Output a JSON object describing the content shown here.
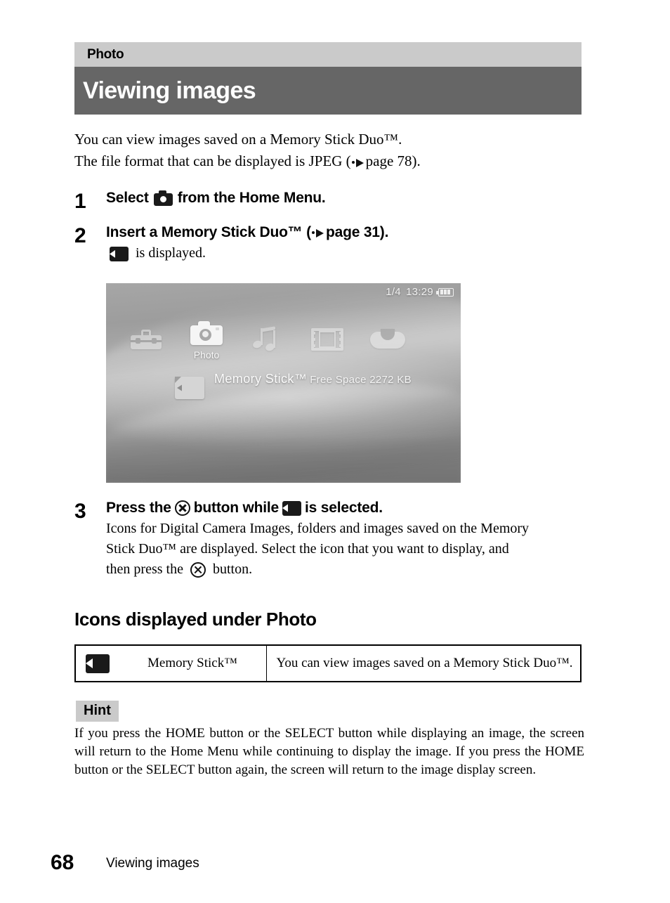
{
  "header": {
    "category": "Photo",
    "title": "Viewing images",
    "category_bg": "#cacaca",
    "title_bg": "#666666",
    "title_color": "#ffffff"
  },
  "intro": {
    "line1": "You can view images saved on a Memory Stick Duo™.",
    "line2_pre": "The file format that can be displayed is JPEG (",
    "line2_ref": "page 78",
    "line2_post": ")."
  },
  "steps": [
    {
      "number": "1",
      "head_pre": "Select",
      "icon": "camera-icon",
      "head_post": "from the Home Menu."
    },
    {
      "number": "2",
      "head_pre": "Insert a Memory Stick Duo™ (",
      "head_ref": "page 31",
      "head_post": ").",
      "body_icon": "memory-stick-icon",
      "body_text": "is displayed."
    },
    {
      "number": "3",
      "head_pre": "Press the",
      "head_mid": "button while",
      "head_post": "is selected.",
      "body_line1": "Icons for Digital Camera Images, folders and images saved on the Memory",
      "body_line2": "Stick Duo™ are displayed. Select the icon that you want to display, and",
      "body_line3_pre": "then press the",
      "body_line3_post": "button."
    }
  ],
  "psp_screen": {
    "status": {
      "date": "1/4",
      "time": "13:29",
      "battery": "battery-icon"
    },
    "xmb_items": [
      {
        "icon": "toolbox-icon",
        "label": "",
        "active": false
      },
      {
        "icon": "camera-icon",
        "label": "Photo",
        "active": true
      },
      {
        "icon": "music-note-icon",
        "label": "",
        "active": false
      },
      {
        "icon": "film-strip-icon",
        "label": "",
        "active": false
      },
      {
        "icon": "game-controller-icon",
        "label": "",
        "active": false
      }
    ],
    "memory_stick": {
      "title": "Memory Stick™",
      "subtitle": "Free Space  2272 KB",
      "icon": "memory-stick-icon"
    }
  },
  "section": {
    "heading": "Icons displayed under Photo"
  },
  "icon_table": {
    "rows": [
      {
        "icon": "memory-stick-icon",
        "label": "Memory Stick™",
        "description": "You can view images saved on a Memory Stick Duo™."
      }
    ]
  },
  "hint": {
    "badge": "Hint",
    "badge_bg": "#cacaca",
    "text": "If you press the HOME button or the SELECT button while displaying an image, the screen will return to the Home Menu while continuing to display the image. If you press the HOME button or the SELECT button again, the screen will return to the image display screen."
  },
  "footer": {
    "page_number": "68",
    "running_title": "Viewing images"
  }
}
